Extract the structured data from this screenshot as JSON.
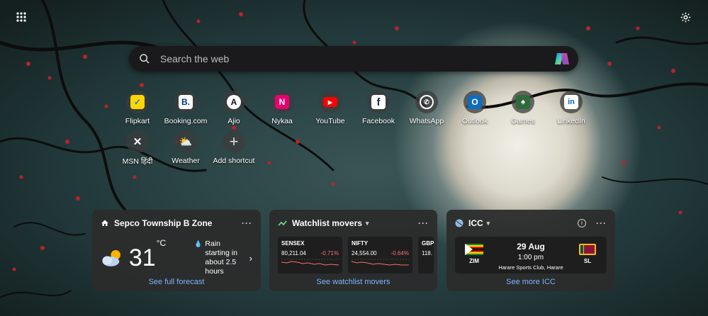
{
  "search": {
    "placeholder": "Search the web"
  },
  "shortcuts": [
    {
      "label": "Flipkart"
    },
    {
      "label": "Booking.com"
    },
    {
      "label": "Ajio"
    },
    {
      "label": "Nykaa"
    },
    {
      "label": "YouTube"
    },
    {
      "label": "Facebook"
    },
    {
      "label": "WhatsApp"
    },
    {
      "label": "Outlook"
    },
    {
      "label": "Games"
    },
    {
      "label": "LinkedIn"
    },
    {
      "label": "MSN हिंदी"
    },
    {
      "label": "Weather"
    },
    {
      "label": "Add shortcut"
    }
  ],
  "weather": {
    "location": "Sepco Township B Zone",
    "temp": "31",
    "unit": "°C",
    "rain_line1": "Rain starting in",
    "rain_line2": "about 2.5 hours",
    "link": "See full forecast"
  },
  "watchlist": {
    "title": "Watchlist movers",
    "tickers": [
      {
        "name": "SENSEX",
        "value": "80,211.04",
        "change": "-0.71%"
      },
      {
        "name": "NIFTY",
        "value": "24,554.00",
        "change": "-0.64%"
      },
      {
        "name": "GBP",
        "value": "118."
      }
    ],
    "link": "See watchlist movers"
  },
  "icc": {
    "title": "ICC",
    "team1": "ZIM",
    "team2": "SL",
    "date": "29 Aug",
    "time": "1:00 pm",
    "venue": "Harare Sports Club, Harare",
    "link": "See more ICC"
  },
  "colors": {
    "accent_link": "#7fb4ff",
    "negative": "#ff6b6b",
    "card_bg": "#2c2c2c"
  }
}
